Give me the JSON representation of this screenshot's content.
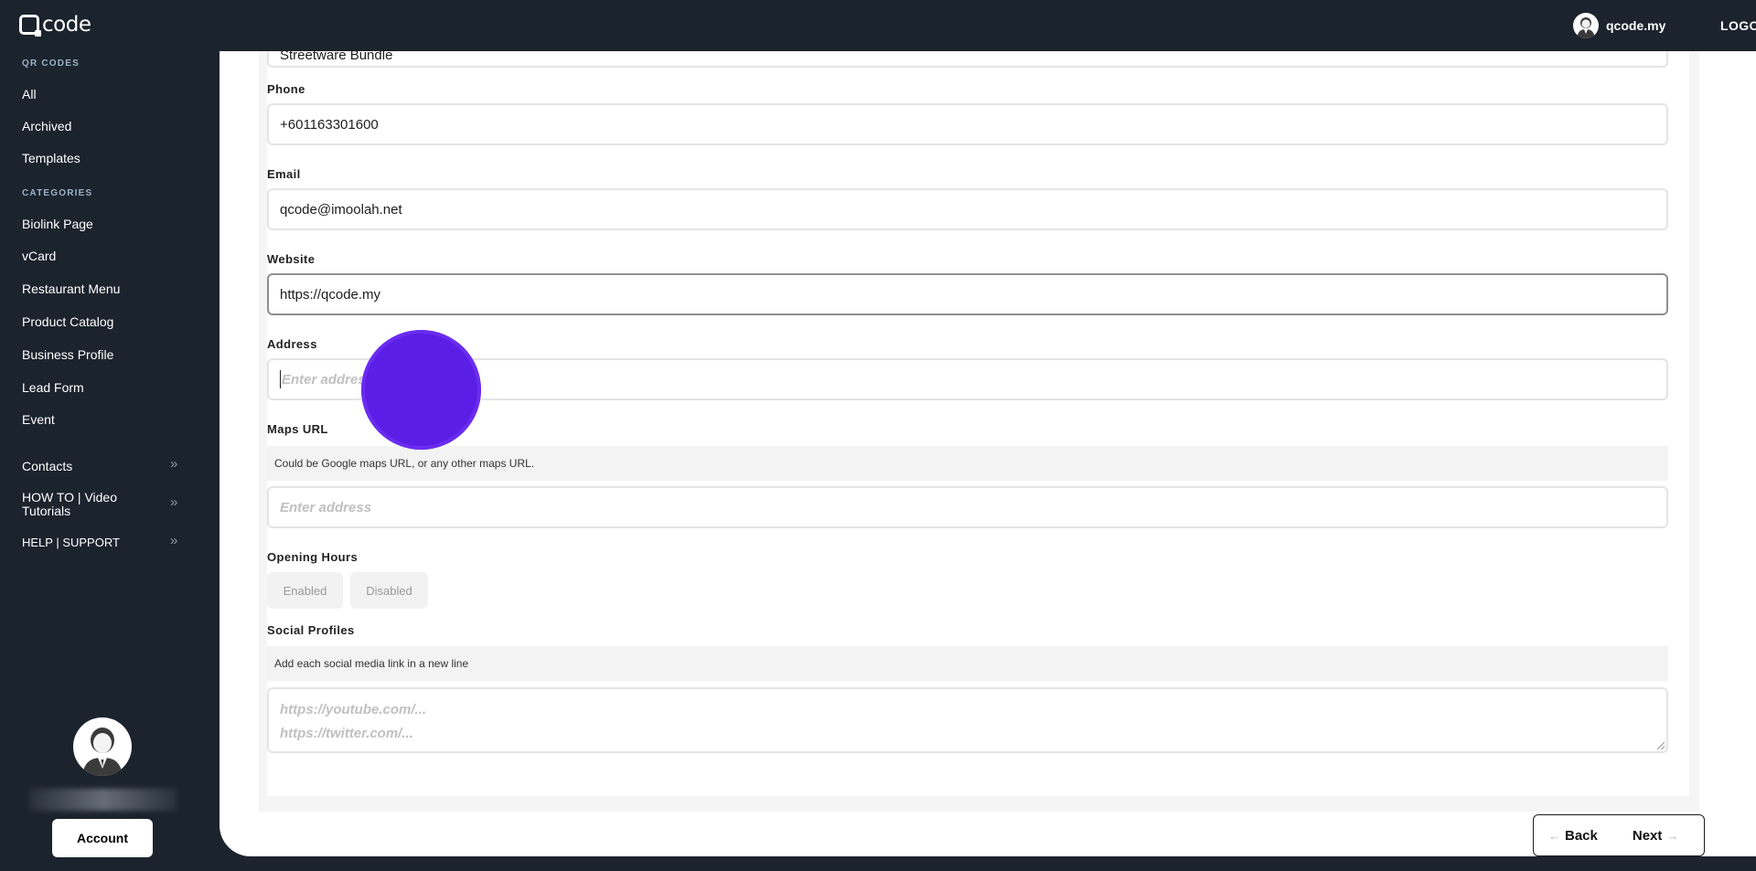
{
  "app": {
    "logo_text": "code",
    "user_name": "qcode.my",
    "logout_label": "LOGOUT"
  },
  "sidebar": {
    "section_qr": "QR CODES",
    "qr_items": [
      "All",
      "Archived",
      "Templates"
    ],
    "section_categories": "CATEGORIES",
    "category_items": [
      "Biolink Page",
      "vCard",
      "Restaurant Menu",
      "Product Catalog",
      "Business Profile",
      "Lead Form",
      "Event"
    ],
    "expandable_items": [
      "Contacts",
      "HOW TO | Video Tutorials",
      "HELP | SUPPORT"
    ],
    "account_label": "Account"
  },
  "form": {
    "top_field_value": "Streetware Bundle",
    "phone": {
      "label": "Phone",
      "value": "+601163301600"
    },
    "email": {
      "label": "Email",
      "value": "qcode@imoolah.net"
    },
    "website": {
      "label": "Website",
      "value": "https://qcode.my"
    },
    "address": {
      "label": "Address",
      "placeholder": "Enter address"
    },
    "maps": {
      "label": "Maps URL",
      "hint": "Could be Google maps URL, or any other maps URL.",
      "placeholder": "Enter address"
    },
    "opening_hours": {
      "label": "Opening Hours",
      "options": [
        "Enabled",
        "Disabled"
      ]
    },
    "social": {
      "label": "Social Profiles",
      "hint": "Add each social media link in a new line",
      "placeholder_lines": [
        "https://youtube.com/...",
        "https://twitter.com/..."
      ]
    }
  },
  "navigation": {
    "back_label": "Back",
    "next_label": "Next"
  },
  "colors": {
    "background": "#1b232d",
    "cursor_indicator": "#5b1ee6"
  }
}
